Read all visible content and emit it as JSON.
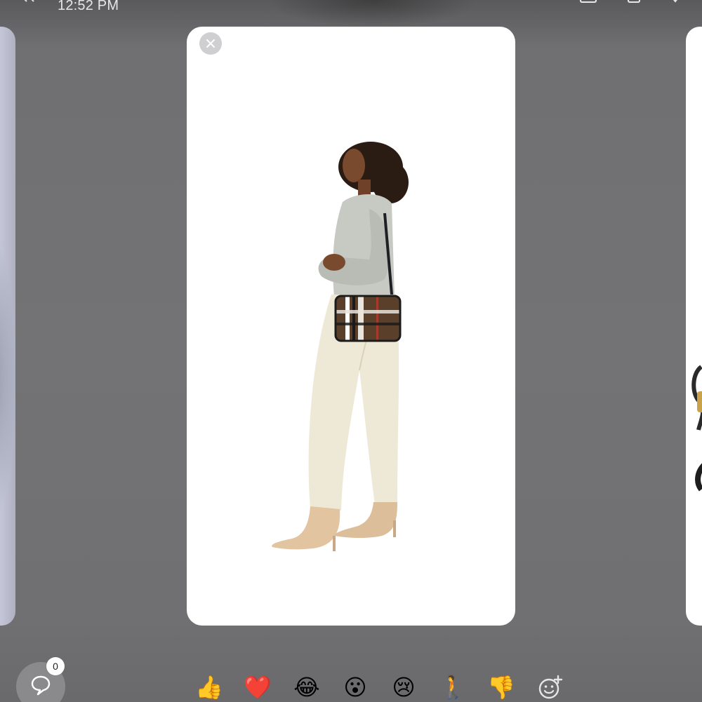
{
  "status_bar": {
    "time": "12:52 PM"
  },
  "story": {
    "close_icon": "close-icon",
    "image_icon": "product-photo-woman-with-plaid-crossbody-bag"
  },
  "comments": {
    "icon": "comment-bubble-icon",
    "count": "0"
  },
  "reactions": [
    {
      "emoji": "👍",
      "name": "thumbs-up"
    },
    {
      "emoji": "❤️",
      "name": "heart"
    },
    {
      "emoji": "😂",
      "name": "laughing"
    },
    {
      "emoji": "😮",
      "name": "surprised"
    },
    {
      "emoji": "😢",
      "name": "crying"
    },
    {
      "emoji": "🚶",
      "name": "person-pose"
    },
    {
      "emoji": "👎",
      "name": "thumbs-down"
    }
  ],
  "add_reaction_icon": "add-emoji-icon",
  "colors": {
    "backdrop": "#707072",
    "card": "#ffffff",
    "close_button_bg": "#cfcfd1",
    "comment_button_bg": "#8a8a8c"
  }
}
